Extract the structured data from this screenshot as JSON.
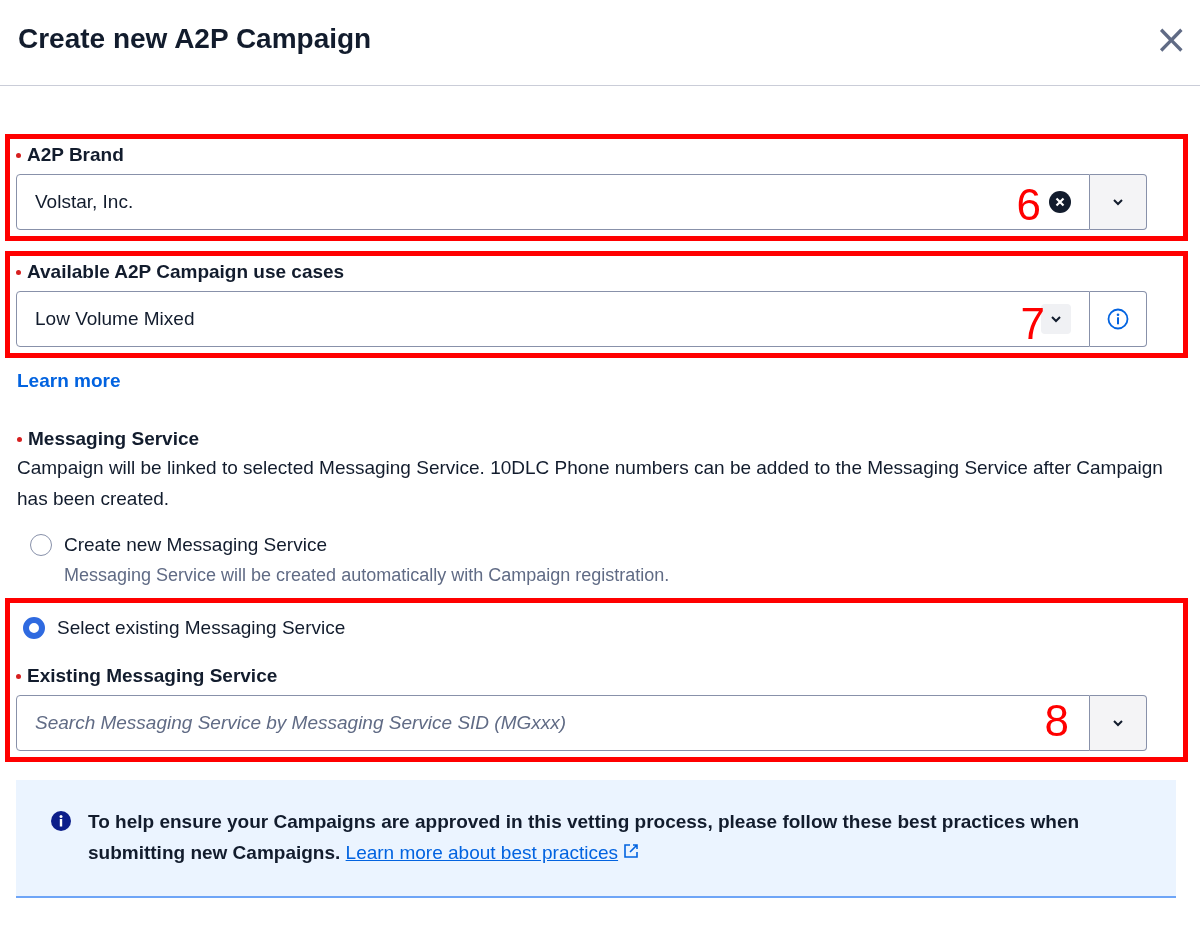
{
  "dialog": {
    "title": "Create new A2P Campaign",
    "close_icon": "×"
  },
  "brand": {
    "label": "A2P Brand",
    "required": true,
    "value": "Volstar, Inc.",
    "clearable": true,
    "annotation": "6"
  },
  "use_case": {
    "label": "Available A2P Campaign use cases",
    "required": true,
    "value": "Low Volume Mixed",
    "info_button": true,
    "annotation": "7",
    "link": "Learn more"
  },
  "messaging_service": {
    "label": "Messaging Service",
    "required": true,
    "description": "Campaign will be linked to selected Messaging Service. 10DLC Phone numbers can be added to the Messaging Service after Campaign has been created.",
    "options": [
      {
        "label": "Create new Messaging Service",
        "description": "Messaging Service will be created automatically with Campaign registration.",
        "selected": false
      },
      {
        "label": "Select existing Messaging Service",
        "selected": true
      }
    ]
  },
  "existing_service": {
    "label": "Existing Messaging Service",
    "required": true,
    "placeholder": "Search Messaging Service by Messaging Service SID (MGxxx)",
    "annotation": "8"
  },
  "notice": {
    "text": "**To help ensure your Campaigns are approved in this vetting process, please follow these best practices when submitting new Campaigns.**",
    "link": "Learn more about best practices"
  }
}
